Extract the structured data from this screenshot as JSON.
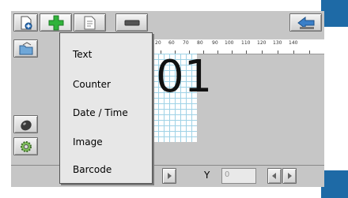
{
  "menu": {
    "items": [
      {
        "label": "Text"
      },
      {
        "label": "Counter"
      },
      {
        "label": "Date / Time"
      },
      {
        "label": "Image"
      },
      {
        "label": "Barcode"
      }
    ]
  },
  "canvas": {
    "preview_text": "01",
    "ruler_ticks": [
      "20",
      "60",
      "70",
      "80",
      "90",
      "100",
      "110",
      "120",
      "130",
      "140"
    ]
  },
  "bottom": {
    "y_label": "Y",
    "y_value": "0"
  },
  "colors": {
    "accent": "#1e6aa6",
    "grid_line": "#9fd2e6",
    "add_icon": "#2fb33a"
  }
}
